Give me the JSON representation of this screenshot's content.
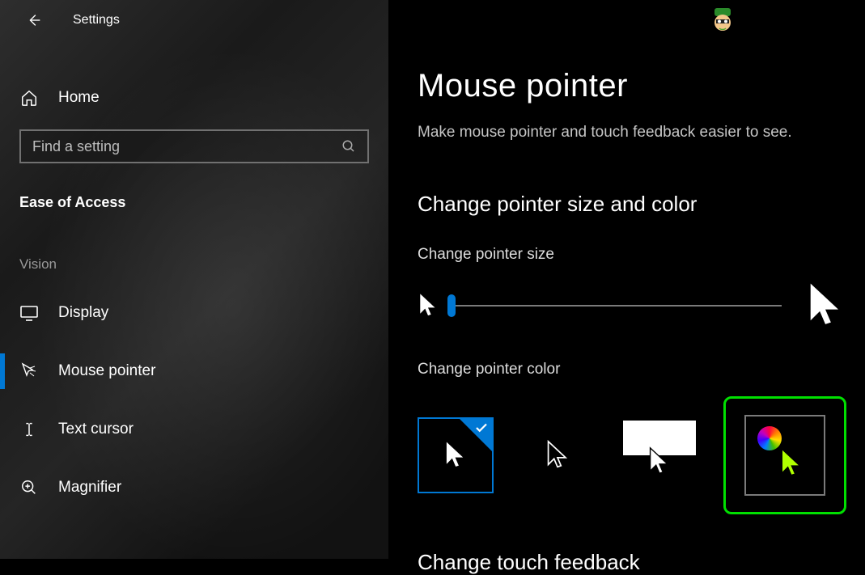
{
  "titlebar": {
    "title": "Settings"
  },
  "sidebar": {
    "home_label": "Home",
    "search_placeholder": "Find a setting",
    "section": "Ease of Access",
    "subsection": "Vision",
    "items": [
      {
        "label": "Display"
      },
      {
        "label": "Mouse pointer"
      },
      {
        "label": "Text cursor"
      },
      {
        "label": "Magnifier"
      }
    ]
  },
  "main": {
    "page_title": "Mouse pointer",
    "description": "Make mouse pointer and touch feedback easier to see.",
    "h_size_color": "Change pointer size and color",
    "h_pointer_size": "Change pointer size",
    "h_pointer_color": "Change pointer color",
    "h_touch": "Change touch feedback"
  }
}
